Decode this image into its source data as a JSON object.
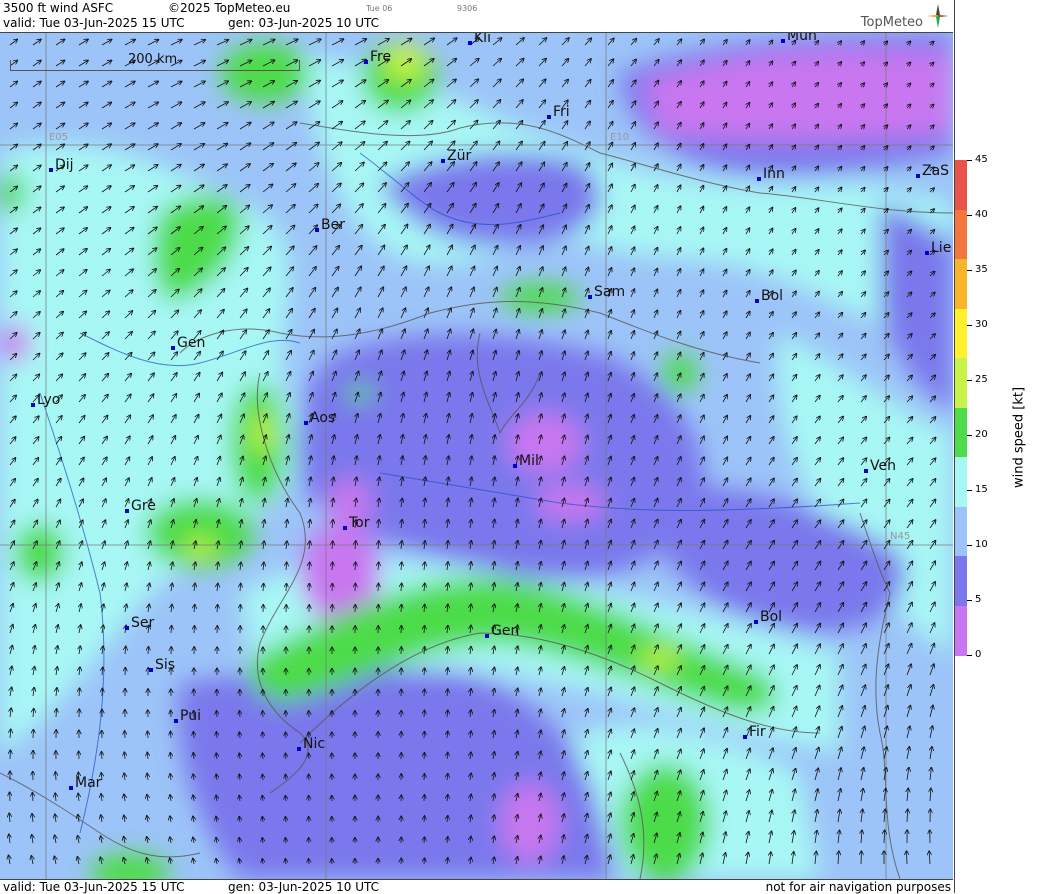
{
  "header": {
    "product": "3500 ft wind ASFC",
    "copyright": "©2025 TopMeteo.eu",
    "day_tag": "Tue 06",
    "code": "9306",
    "valid": "valid:  Tue  03-Jun-2025  15 UTC",
    "gen": "gen: 03-Jun-2025 10 UTC",
    "logo": "TopMeteo"
  },
  "footer": {
    "valid": "valid:  Tue  03-Jun-2025  15 UTC",
    "gen": "gen: 03-Jun-2025 10 UTC",
    "disclaimer": "not for air navigation purposes"
  },
  "scalebar": {
    "label": "200 km"
  },
  "grid_labels": {
    "e05": "E05",
    "e10": "E10",
    "n45": "N45"
  },
  "legend": {
    "title": "wind speed [kt]",
    "ticks": [
      "45",
      "40",
      "35",
      "30",
      "25",
      "20",
      "15",
      "10",
      "5",
      "0"
    ],
    "colors": [
      "#e8534a",
      "#f2773e",
      "#f7b52a",
      "#fff130",
      "#c8f34a",
      "#4edc4a",
      "#a7f7f5",
      "#9cc4f8",
      "#7a78ec",
      "#c877f0"
    ]
  },
  "cities": [
    {
      "name": "Kli"
    },
    {
      "name": "Mün"
    },
    {
      "name": "Fre"
    },
    {
      "name": "Fri"
    },
    {
      "name": "Dij"
    },
    {
      "name": "Zür"
    },
    {
      "name": "Inn"
    },
    {
      "name": "ZaS"
    },
    {
      "name": "Ber"
    },
    {
      "name": "Lie"
    },
    {
      "name": "Sam"
    },
    {
      "name": "Bol"
    },
    {
      "name": "Gen"
    },
    {
      "name": "Lyo"
    },
    {
      "name": "Aos"
    },
    {
      "name": "Mil"
    },
    {
      "name": "Ven"
    },
    {
      "name": "Gre"
    },
    {
      "name": "Tor"
    },
    {
      "name": "Ser"
    },
    {
      "name": "Bol"
    },
    {
      "name": "Gen"
    },
    {
      "name": "Sis"
    },
    {
      "name": "Pui"
    },
    {
      "name": "Fir"
    },
    {
      "name": "Nic"
    },
    {
      "name": "Mar"
    }
  ]
}
